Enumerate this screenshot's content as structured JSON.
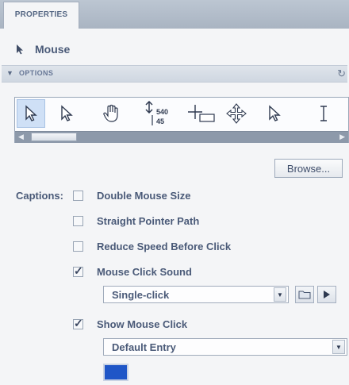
{
  "tab": {
    "label": "PROPERTIES"
  },
  "object": {
    "name": "Mouse",
    "icon": "arrow-pointer-icon"
  },
  "section": {
    "label": "OPTIONS"
  },
  "pointer_list": {
    "items": [
      {
        "icon": "arrow-cursor-icon",
        "selected": true
      },
      {
        "icon": "arrow-outline-cursor-icon",
        "selected": false
      },
      {
        "icon": "hand-cursor-icon",
        "selected": false
      },
      {
        "icon": "resize-cursor-icon",
        "selected": false
      },
      {
        "icon": "crosshair-cursor-icon",
        "selected": false
      },
      {
        "icon": "move-cursor-icon",
        "selected": false
      },
      {
        "icon": "arrow-outline-cursor-icon",
        "selected": false
      },
      {
        "icon": "text-cursor-icon",
        "selected": false
      }
    ],
    "resize_readout": [
      "540",
      "45"
    ]
  },
  "browse_button": {
    "label": "Browse..."
  },
  "captions": {
    "label": "Captions:",
    "options": [
      {
        "label": "Double Mouse Size",
        "checked": false
      },
      {
        "label": "Straight Pointer Path",
        "checked": false
      },
      {
        "label": "Reduce Speed Before Click",
        "checked": false
      },
      {
        "label": "Mouse Click Sound",
        "checked": true
      },
      {
        "label": "Show Mouse Click",
        "checked": true
      }
    ]
  },
  "sound_select": {
    "value": "Single-click"
  },
  "click_select": {
    "value": "Default Entry"
  },
  "colors": {
    "accent": "#1f56c7",
    "selection": "#cfe0f6"
  }
}
